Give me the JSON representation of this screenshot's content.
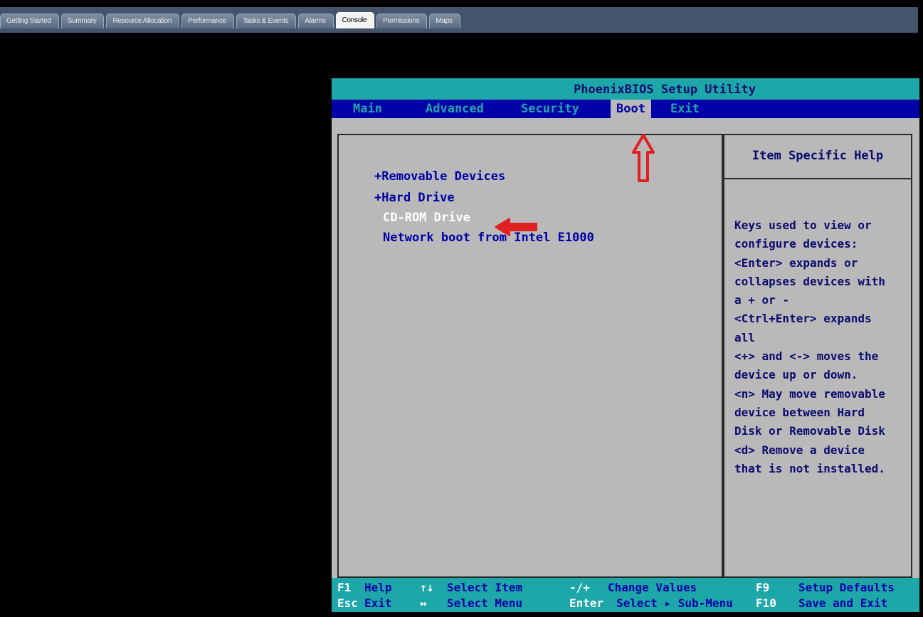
{
  "vsphere_tabs": [
    {
      "label": "Getting Started",
      "active": false
    },
    {
      "label": "Summary",
      "active": false
    },
    {
      "label": "Resource Allocation",
      "active": false
    },
    {
      "label": "Performance",
      "active": false
    },
    {
      "label": "Tasks & Events",
      "active": false
    },
    {
      "label": "Alarms",
      "active": false
    },
    {
      "label": "Console",
      "active": true
    },
    {
      "label": "Permissions",
      "active": false
    },
    {
      "label": "Maps",
      "active": false
    }
  ],
  "bios": {
    "title": "PhoenixBIOS Setup Utility",
    "menu": [
      {
        "label": "Main",
        "active": false
      },
      {
        "label": "Advanced",
        "active": false
      },
      {
        "label": "Security",
        "active": false
      },
      {
        "label": "Boot",
        "active": true
      },
      {
        "label": "Exit",
        "active": false
      }
    ],
    "boot_items": [
      {
        "label": "+Removable Devices",
        "selected": false
      },
      {
        "label": "+Hard Drive",
        "selected": false
      },
      {
        "label": "CD-ROM Drive",
        "selected": true
      },
      {
        "label": "Network boot from Intel E1000",
        "selected": false
      }
    ],
    "help": {
      "title": "Item Specific Help",
      "lines": [
        "Keys used to view or",
        "configure devices:",
        "<Enter> expands or",
        "collapses devices with",
        "a + or -",
        "<Ctrl+Enter> expands",
        "all",
        "<+> and <-> moves the",
        "device up or down.",
        "<n> May move removable",
        "device between Hard",
        "Disk or Removable Disk",
        "<d> Remove a device",
        "that is not installed."
      ]
    },
    "footer": {
      "row1": {
        "k1": "F1",
        "t1": "Help",
        "k2": "↑↓",
        "t2": "Select Item",
        "k3": "-/+",
        "t3": "Change Values",
        "k4": "F9",
        "t4": "Setup Defaults"
      },
      "row2": {
        "k1": "Esc",
        "t1": "Exit",
        "k2": "↔",
        "t2": "Select Menu",
        "k3": "Enter",
        "t3": "Select ▸ Sub-Menu",
        "k4": "F10",
        "t4": "Save and Exit"
      }
    }
  },
  "colors": {
    "tab_bar": "#44546b",
    "bios_cyan": "#1ea7a8",
    "bios_blue": "#0000a8",
    "bios_gray": "#b9b9b9",
    "annotation_red": "#e02020"
  }
}
